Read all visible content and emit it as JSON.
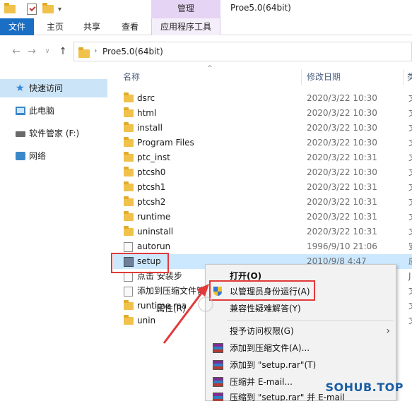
{
  "titlebar": {
    "manage_tab": "管理",
    "window_title": "Proe5.0(64bit)"
  },
  "ribbon": {
    "tabs": [
      "文件",
      "主页",
      "共享",
      "查看",
      "应用程序工具"
    ]
  },
  "address": {
    "path": "Proe5.0(64bit)"
  },
  "nav": {
    "items": [
      {
        "label": "快速访问",
        "icon": "star-icon"
      },
      {
        "label": "此电脑",
        "icon": "computer-icon"
      },
      {
        "label": "软件管家 (F:)",
        "icon": "drive-icon"
      },
      {
        "label": "网络",
        "icon": "network-icon"
      }
    ]
  },
  "columns": {
    "name": "名称",
    "date": "修改日期",
    "type": "类"
  },
  "files": [
    {
      "name": "dsrc",
      "date": "2020/3/22 10:30",
      "type": "文",
      "kind": "folder"
    },
    {
      "name": "html",
      "date": "2020/3/22 10:30",
      "type": "文",
      "kind": "folder"
    },
    {
      "name": "install",
      "date": "2020/3/22 10:30",
      "type": "文",
      "kind": "folder"
    },
    {
      "name": "Program Files",
      "date": "2020/3/22 10:30",
      "type": "文",
      "kind": "folder"
    },
    {
      "name": "ptc_inst",
      "date": "2020/3/22 10:31",
      "type": "文",
      "kind": "folder"
    },
    {
      "name": "ptcsh0",
      "date": "2020/3/22 10:30",
      "type": "文",
      "kind": "folder"
    },
    {
      "name": "ptcsh1",
      "date": "2020/3/22 10:31",
      "type": "文",
      "kind": "folder"
    },
    {
      "name": "ptcsh2",
      "date": "2020/3/22 10:31",
      "type": "文",
      "kind": "folder"
    },
    {
      "name": "runtime",
      "date": "2020/3/22 10:31",
      "type": "文",
      "kind": "folder"
    },
    {
      "name": "uninstall",
      "date": "2020/3/22 10:31",
      "type": "文",
      "kind": "folder"
    },
    {
      "name": "autorun",
      "date": "1996/9/10 21:06",
      "type": "安",
      "kind": "file"
    },
    {
      "name": "setup",
      "date": "2010/9/8 4:47",
      "type": "应",
      "kind": "exe"
    },
    {
      "name": "点击 安装步",
      "date": "",
      "type": "J",
      "kind": "file"
    },
    {
      "name": "添加到压缩文件管",
      "date": "",
      "type": "文",
      "kind": "file"
    },
    {
      "name": "runtime ma",
      "date": "",
      "type": "文",
      "kind": "folder"
    },
    {
      "name": "unin",
      "date": "",
      "type": "文",
      "kind": "folder"
    }
  ],
  "ghost_labels": {
    "attrs": "属性(R)"
  },
  "context_menu": {
    "items": [
      {
        "label": "打开(O)",
        "bold": true,
        "icon": ""
      },
      {
        "label": "以管理员身份运行(A)",
        "bold": false,
        "icon": "uac-shield-icon"
      },
      {
        "label": "兼容性疑难解答(Y)",
        "bold": false,
        "icon": ""
      },
      {
        "label": "授予访问权限(G)",
        "bold": false,
        "icon": "",
        "submenu": true
      },
      {
        "label": "添加到压缩文件(A)...",
        "bold": false,
        "icon": "winrar-icon"
      },
      {
        "label": "添加到 \"setup.rar\"(T)",
        "bold": false,
        "icon": "winrar-icon"
      },
      {
        "label": "压缩并 E-mail...",
        "bold": false,
        "icon": "winrar-icon"
      },
      {
        "label": "压缩到 \"setup.rar\" 并 E-mail",
        "bold": false,
        "icon": "winrar-icon"
      }
    ]
  },
  "watermark": "SOHUB.TOP",
  "colors": {
    "accent": "#1a6fc4",
    "selection": "#cce8ff",
    "highlight_red": "#e23a3a",
    "manage_tab": "#e6d4f4"
  }
}
